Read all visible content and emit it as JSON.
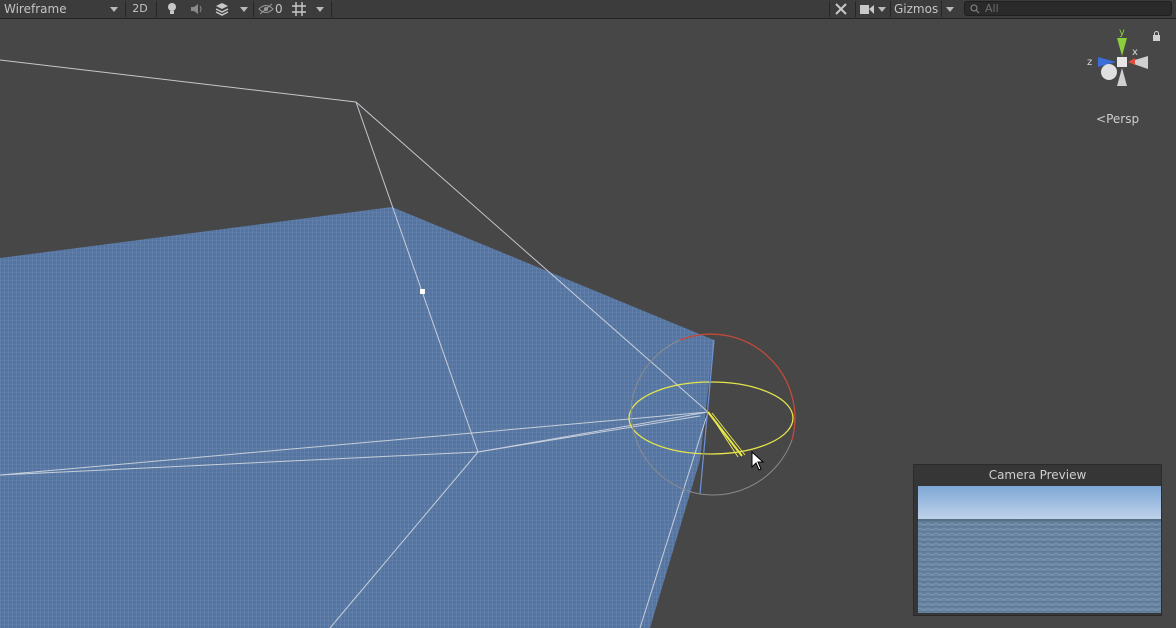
{
  "toolbar": {
    "shading_mode": "Wireframe",
    "mode_2d": "2D",
    "hidden_count": "0",
    "gizmos_label": "Gizmos",
    "search_placeholder": "All"
  },
  "scene": {
    "projection_label": "Persp",
    "axis_labels": {
      "y": "y",
      "x": "x",
      "z": "z"
    },
    "colors": {
      "background": "#474747",
      "plane": "#5a7aa8",
      "wire": "#d9dde3",
      "light_gizmo_yellow": "#e6e64c",
      "light_gizmo_red": "#c44a3a"
    }
  },
  "camera_preview": {
    "title": "Camera Preview"
  }
}
